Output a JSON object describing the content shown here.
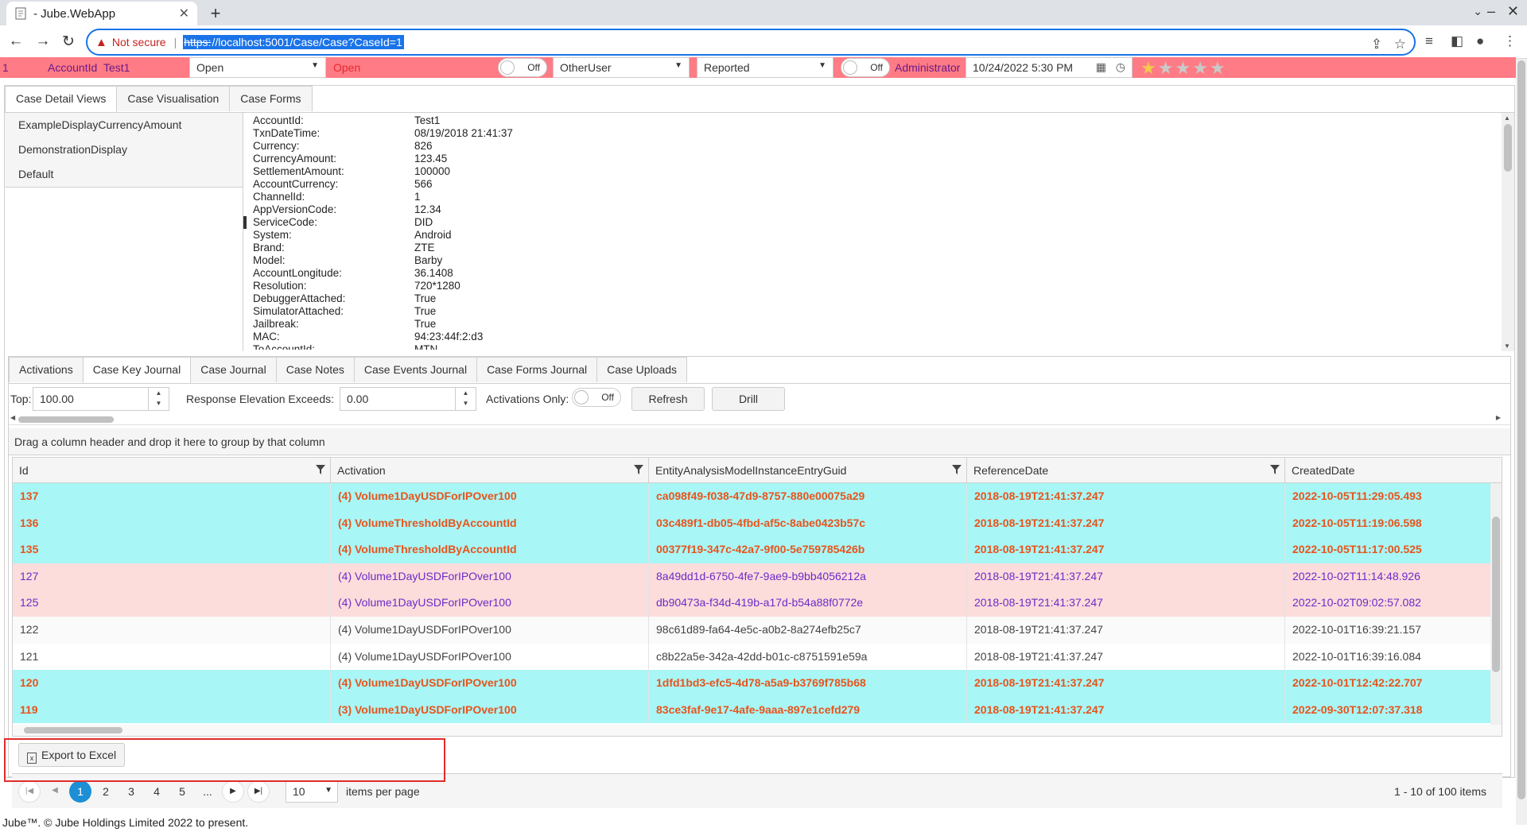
{
  "browser": {
    "tab_title": "- Jube.WebApp",
    "not_secure": "Not secure",
    "url_scheme": "https:",
    "url_rest": "//localhost:5001/Case/Case?CaseId=1"
  },
  "case_header": {
    "id": "1",
    "key": "AccountId",
    "key_value": "Test1",
    "status_select": "Open",
    "status_text": "Open",
    "toggle1": "Off",
    "user_select": "OtherUser",
    "state_select": "Reported",
    "toggle2": "Off",
    "locked_by": "Administrator",
    "datetime": "10/24/2022 5:30 PM",
    "rating": 1
  },
  "detail_tabs": [
    "Case Detail Views",
    "Case Visualisation",
    "Case Forms"
  ],
  "views": [
    "ExampleDisplayCurrencyAmount",
    "DemonstrationDisplay",
    "Default"
  ],
  "payload": [
    [
      "AccountId:",
      "Test1"
    ],
    [
      "TxnDateTime:",
      "08/19/2018 21:41:37"
    ],
    [
      "Currency:",
      "826"
    ],
    [
      "CurrencyAmount:",
      "123.45"
    ],
    [
      "SettlementAmount:",
      "100000"
    ],
    [
      "AccountCurrency:",
      "566"
    ],
    [
      "ChannelId:",
      "1"
    ],
    [
      "AppVersionCode:",
      "12.34"
    ],
    [
      "ServiceCode:",
      "DID"
    ],
    [
      "System:",
      "Android"
    ],
    [
      "Brand:",
      "ZTE"
    ],
    [
      "Model:",
      "Barby"
    ],
    [
      "AccountLongitude:",
      "36.1408"
    ],
    [
      "Resolution:",
      "720*1280"
    ],
    [
      "DebuggerAttached:",
      "True"
    ],
    [
      "SimulatorAttached:",
      "True"
    ],
    [
      "Jailbreak:",
      "True"
    ],
    [
      "MAC:",
      "94:23:44f:2:d3"
    ],
    [
      "ToAccountId:",
      "MTN"
    ]
  ],
  "journal_tabs": [
    "Activations",
    "Case Key Journal",
    "Case Journal",
    "Case Notes",
    "Case Events Journal",
    "Case Forms Journal",
    "Case Uploads"
  ],
  "filters": {
    "top_label": "Top:",
    "top_value": "100.00",
    "elev_label": "Response Elevation Exceeds:",
    "elev_value": "0.00",
    "act_only_label": "Activations Only:",
    "act_only_toggle": "Off",
    "refresh": "Refresh",
    "drill": "Drill"
  },
  "group_hint": "Drag a column header and drop it here to group by that column",
  "columns": [
    "Id",
    "Activation",
    "EntityAnalysisModelInstanceEntryGuid",
    "ReferenceDate",
    "CreatedDate"
  ],
  "rows": [
    {
      "style": "cyan",
      "cells": [
        "137",
        "(4) Volume1DayUSDForIPOver100",
        "ca098f49-f038-47d9-8757-880e00075a29",
        "2018-08-19T21:41:37.247",
        "2022-10-05T11:29:05.493"
      ]
    },
    {
      "style": "cyan",
      "cells": [
        "136",
        "(4) VolumeThresholdByAccountId",
        "03c489f1-db05-4fbd-af5c-8abe0423b57c",
        "2018-08-19T21:41:37.247",
        "2022-10-05T11:19:06.598"
      ]
    },
    {
      "style": "cyan",
      "cells": [
        "135",
        "(4) VolumeThresholdByAccountId",
        "00377f19-347c-42a7-9f00-5e759785426b",
        "2018-08-19T21:41:37.247",
        "2022-10-05T11:17:00.525"
      ]
    },
    {
      "style": "pink",
      "cells": [
        "127",
        "(4) Volume1DayUSDForIPOver100",
        "8a49dd1d-6750-4fe7-9ae9-b9bb4056212a",
        "2018-08-19T21:41:37.247",
        "2022-10-02T11:14:48.926"
      ]
    },
    {
      "style": "pink",
      "cells": [
        "125",
        "(4) Volume1DayUSDForIPOver100",
        "db90473a-f34d-419b-a17d-b54a88f0772e",
        "2018-08-19T21:41:37.247",
        "2022-10-02T09:02:57.082"
      ]
    },
    {
      "style": "plain-a",
      "cells": [
        "122",
        "(4) Volume1DayUSDForIPOver100",
        "98c61d89-fa64-4e5c-a0b2-8a274efb25c7",
        "2018-08-19T21:41:37.247",
        "2022-10-01T16:39:21.157"
      ]
    },
    {
      "style": "plain-b",
      "cells": [
        "121",
        "(4) Volume1DayUSDForIPOver100",
        "c8b22a5e-342a-42dd-b01c-c8751591e59a",
        "2018-08-19T21:41:37.247",
        "2022-10-01T16:39:16.084"
      ]
    },
    {
      "style": "cyan",
      "cells": [
        "120",
        "(4) Volume1DayUSDForIPOver100",
        "1dfd1bd3-efc5-4d78-a5a9-b3769f785b68",
        "2018-08-19T21:41:37.247",
        "2022-10-01T12:42:22.707"
      ]
    },
    {
      "style": "cyan",
      "cells": [
        "119",
        "(3) Volume1DayUSDForIPOver100",
        "83ce3faf-9e17-4afe-9aaa-897e1cefd279",
        "2018-08-19T21:41:37.247",
        "2022-09-30T12:07:37.318"
      ]
    }
  ],
  "export_label": "Export to Excel",
  "pager": {
    "pages": [
      "1",
      "2",
      "3",
      "4",
      "5",
      "..."
    ],
    "current": "1",
    "page_size": "10",
    "items_per_page": "items per page",
    "summary": "1 - 10 of 100 items"
  },
  "footer": "Jube™. © Jube Holdings Limited 2022 to present.",
  "colors": {
    "case_bar": "#ff7b85",
    "highlight_cyan": "#a8f6f6",
    "highlight_pink": "#fddcdc",
    "accent": "#1d8fd4",
    "annotation_box": "#e32b2b"
  }
}
